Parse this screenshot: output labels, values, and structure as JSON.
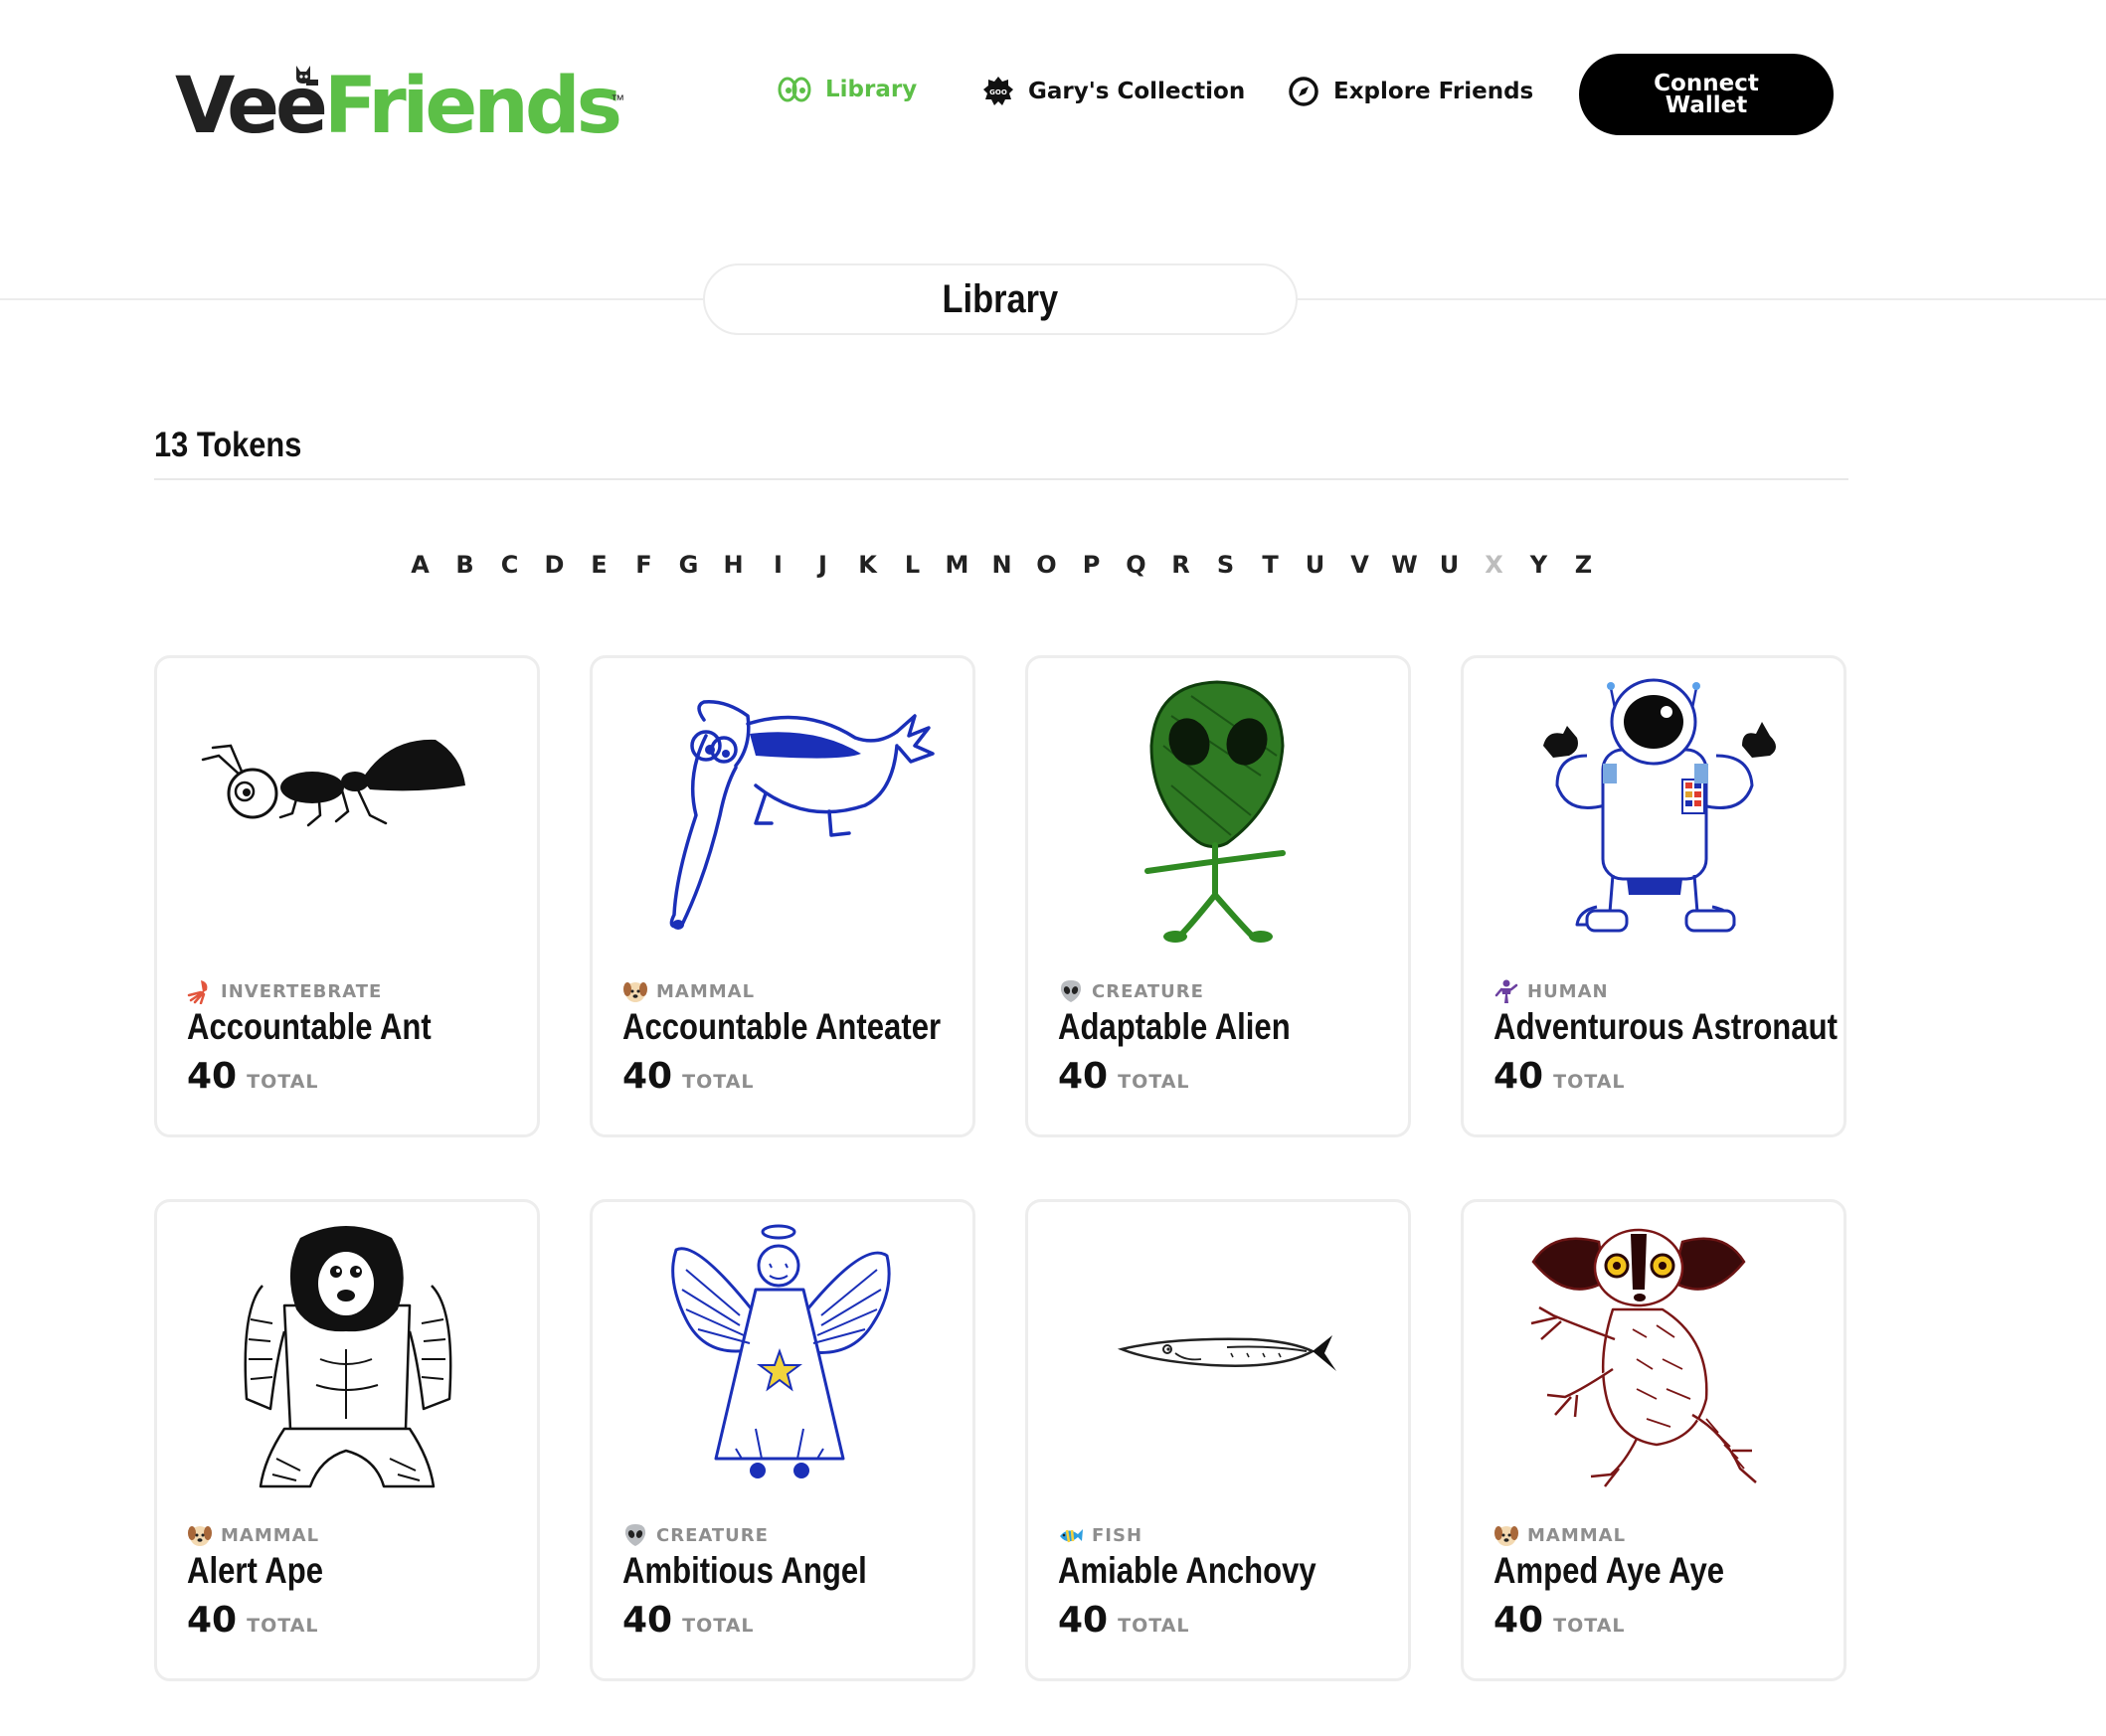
{
  "header": {
    "logo": {
      "part1": "Vee",
      "part2": "Friends",
      "tm": "™"
    },
    "nav": [
      {
        "label": "Library",
        "active": true,
        "icon": "eyes-icon"
      },
      {
        "label": "Gary's Collection",
        "active": false,
        "icon": "gary-badge-icon"
      },
      {
        "label": "Explore Friends",
        "active": false,
        "icon": "compass-icon"
      }
    ],
    "connect_button": "Connect\nWallet"
  },
  "library_title": "Library",
  "tokens_count": "13 Tokens",
  "alphabet": [
    {
      "letter": "A",
      "enabled": true
    },
    {
      "letter": "B",
      "enabled": true
    },
    {
      "letter": "C",
      "enabled": true
    },
    {
      "letter": "D",
      "enabled": true
    },
    {
      "letter": "E",
      "enabled": true
    },
    {
      "letter": "F",
      "enabled": true
    },
    {
      "letter": "G",
      "enabled": true
    },
    {
      "letter": "H",
      "enabled": true
    },
    {
      "letter": "I",
      "enabled": true
    },
    {
      "letter": "J",
      "enabled": true
    },
    {
      "letter": "K",
      "enabled": true
    },
    {
      "letter": "L",
      "enabled": true
    },
    {
      "letter": "M",
      "enabled": true
    },
    {
      "letter": "N",
      "enabled": true
    },
    {
      "letter": "O",
      "enabled": true
    },
    {
      "letter": "P",
      "enabled": true
    },
    {
      "letter": "Q",
      "enabled": true
    },
    {
      "letter": "R",
      "enabled": true
    },
    {
      "letter": "S",
      "enabled": true
    },
    {
      "letter": "T",
      "enabled": true
    },
    {
      "letter": "U",
      "enabled": true
    },
    {
      "letter": "V",
      "enabled": true
    },
    {
      "letter": "W",
      "enabled": true
    },
    {
      "letter": "U",
      "enabled": true
    },
    {
      "letter": "X",
      "enabled": false
    },
    {
      "letter": "Y",
      "enabled": true
    },
    {
      "letter": "Z",
      "enabled": true
    }
  ],
  "cards": [
    {
      "category": "INVERTEBRATE",
      "category_icon": "squid-icon",
      "name": "Accountable Ant",
      "total": "40",
      "total_label": "TOTAL",
      "art": "ant-drawing"
    },
    {
      "category": "MAMMAL",
      "category_icon": "dog-face-icon",
      "name": "Accountable Anteater",
      "total": "40",
      "total_label": "TOTAL",
      "art": "anteater-drawing"
    },
    {
      "category": "CREATURE",
      "category_icon": "alien-icon",
      "name": "Adaptable Alien",
      "total": "40",
      "total_label": "TOTAL",
      "art": "alien-drawing"
    },
    {
      "category": "HUMAN",
      "category_icon": "person-icon",
      "name": "Adventurous Astronaut",
      "total": "40",
      "total_label": "TOTAL",
      "art": "astronaut-drawing"
    },
    {
      "category": "MAMMAL",
      "category_icon": "dog-face-icon",
      "name": "Alert Ape",
      "total": "40",
      "total_label": "TOTAL",
      "art": "ape-drawing"
    },
    {
      "category": "CREATURE",
      "category_icon": "alien-icon",
      "name": "Ambitious Angel",
      "total": "40",
      "total_label": "TOTAL",
      "art": "angel-drawing"
    },
    {
      "category": "FISH",
      "category_icon": "tropical-fish-icon",
      "name": "Amiable Anchovy",
      "total": "40",
      "total_label": "TOTAL",
      "art": "anchovy-drawing"
    },
    {
      "category": "MAMMAL",
      "category_icon": "dog-face-icon",
      "name": "Amped Aye Aye",
      "total": "40",
      "total_label": "TOTAL",
      "art": "aye-aye-drawing"
    }
  ],
  "colors": {
    "accent": "#5cbf47",
    "text": "#111111",
    "muted": "#8e8e8e",
    "border": "#ededed",
    "disabled_letter": "#bdbdbd"
  }
}
